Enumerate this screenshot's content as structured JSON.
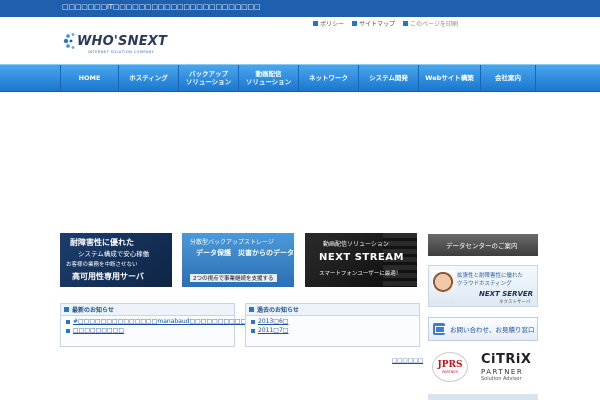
{
  "header": {
    "tagline": "□□□□□□□IT□□□□□□□□□□□□□□□□□□□□□□□",
    "logo": {
      "word": "WHO'S",
      "word2": "NEXT",
      "sub": "INTERNET SOLUTION COMPANY"
    },
    "links": [
      {
        "label": "ポリシー"
      },
      {
        "label": "サイトマップ"
      },
      {
        "label": "このページを印刷"
      }
    ]
  },
  "nav": {
    "items": [
      {
        "label": "HOME",
        "label2": ""
      },
      {
        "label": "ホスティング",
        "label2": ""
      },
      {
        "label": "バックアップ",
        "label2": "ソリューション"
      },
      {
        "label": "動画配信",
        "label2": "ソリューション"
      },
      {
        "label": "ネットワーク",
        "label2": ""
      },
      {
        "label": "システム開発",
        "label2": ""
      },
      {
        "label": "Webサイト構築",
        "label2": ""
      },
      {
        "label": "会社案内",
        "label2": ""
      }
    ]
  },
  "banners": {
    "b1": {
      "l1": "耐障害性に優れた",
      "l2": "システム構成で安心稼働",
      "l3": "お客様の業務を中断させない",
      "l4": "高可用性専用サーバ"
    },
    "b2": {
      "l1": "分散型バックアップストレージ",
      "l2": "データ保護　災害からのデータ復旧",
      "l3": "2つの視点で事業継続を支援する"
    },
    "b3": {
      "l1": "動画配信ソリューション",
      "l2": "NEXT STREAM",
      "l3": "スマートフォンユーザーに最適！"
    }
  },
  "news": {
    "latest": {
      "title": "最新のお知らせ",
      "items": [
        "#□□□□□□□□□□□□□□manabaud□□□□□□□□□□",
        "□□□□□□□□□"
      ]
    },
    "past": {
      "title": "過去のお知らせ",
      "items": [
        "2013□6□",
        "2011□7□"
      ]
    },
    "more": "□□□□□□"
  },
  "sidebar": {
    "datacenter": "データセンターのご案内",
    "nextserver": {
      "s1": "拡張性と耐障害性に優れた",
      "s2": "クラウドホスティング",
      "s3": "NEXT SERVER",
      "s4": "ネクストサーバ"
    },
    "contact": "お問い合わせ、お見積り窓口",
    "jprs": {
      "a": "JPRS",
      "b": "PARTNER"
    },
    "citrix": {
      "a": "CiTRiX",
      "b": "PARTNER",
      "c": "Solution Advisor"
    }
  }
}
